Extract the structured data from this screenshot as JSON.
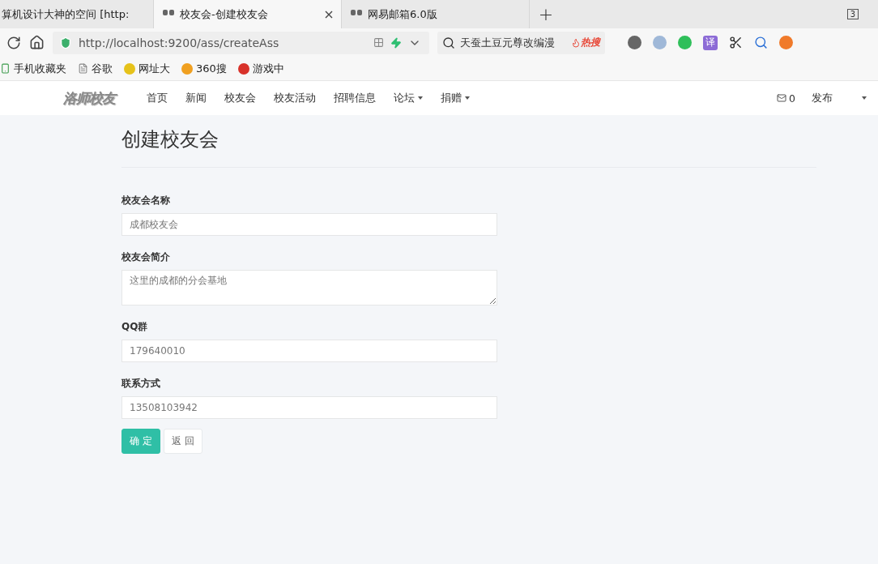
{
  "browser": {
    "tabs": [
      {
        "title": "算机设计大神的空间 [http:",
        "selected": false,
        "closable": false
      },
      {
        "title": "校友会-创建校友会",
        "selected": true,
        "closable": true
      },
      {
        "title": "网易邮箱6.0版",
        "selected": false,
        "closable": false
      }
    ],
    "new_tab": "+",
    "tab_count": "3",
    "url": "http://localhost:9200/ass/createAss",
    "search": {
      "placeholder": "天蚕土豆元尊改编漫",
      "hot": "热搜"
    },
    "translate": "译",
    "bookmarks": [
      "手机收藏夹",
      "谷歌",
      "网址大",
      "360搜",
      "游戏中"
    ]
  },
  "navbar": {
    "logo": "洛师校友",
    "items": [
      {
        "label": "首页",
        "dropdown": false
      },
      {
        "label": "新闻",
        "dropdown": false
      },
      {
        "label": "校友会",
        "dropdown": false
      },
      {
        "label": "校友活动",
        "dropdown": false
      },
      {
        "label": "招聘信息",
        "dropdown": false
      },
      {
        "label": "论坛",
        "dropdown": true
      },
      {
        "label": "捐赠",
        "dropdown": true
      }
    ],
    "messages": "0",
    "publish": "发布"
  },
  "page_title": "创建校友会",
  "form": {
    "fields": [
      {
        "kind": "input",
        "label": "校友会名称",
        "placeholder": "成都校友会"
      },
      {
        "kind": "textarea",
        "label": "校友会简介",
        "placeholder": "这里的成都的分会基地"
      },
      {
        "kind": "input",
        "label": "QQ群",
        "placeholder": "179640010"
      },
      {
        "kind": "input",
        "label": "联系方式",
        "placeholder": "13508103942"
      }
    ],
    "buttons": [
      {
        "label": "确 定",
        "kind": "primary"
      },
      {
        "label": "返 回",
        "kind": "default"
      }
    ]
  }
}
